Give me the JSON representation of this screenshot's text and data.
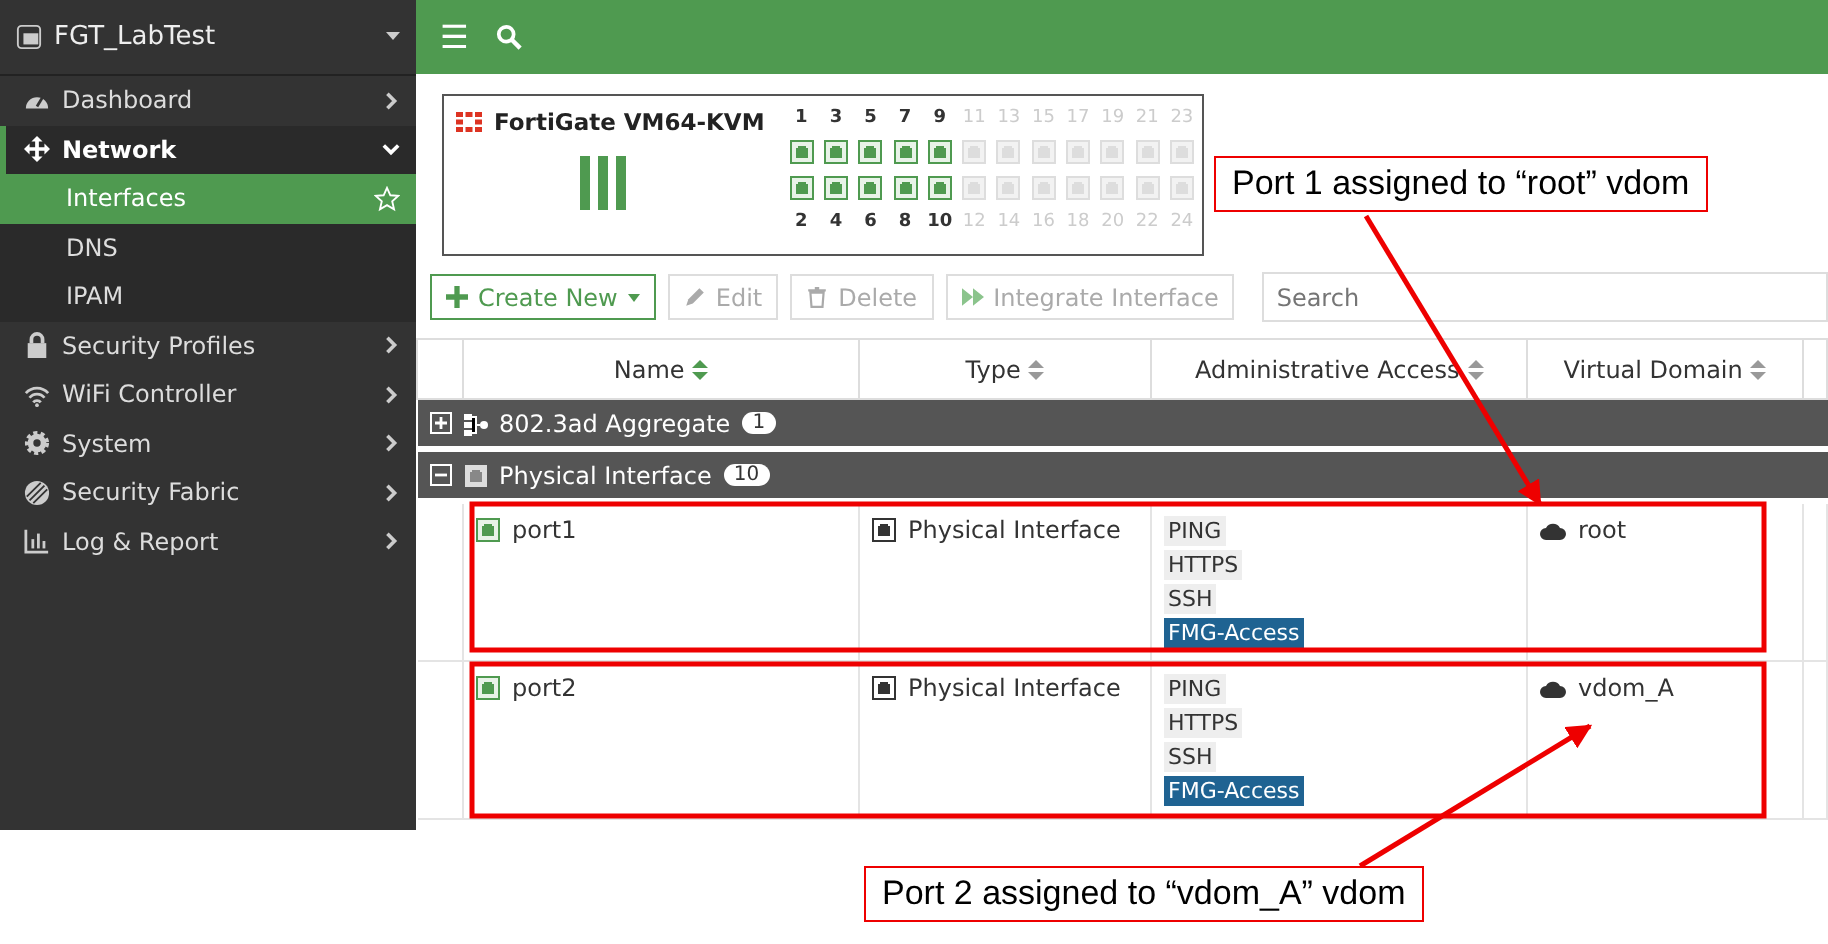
{
  "sidebar": {
    "device": "FGT_LabTest",
    "items": [
      {
        "label": "Dashboard",
        "expanded": false
      },
      {
        "label": "Network",
        "expanded": true,
        "children": [
          {
            "label": "Interfaces",
            "selected": true
          },
          {
            "label": "DNS",
            "selected": false
          },
          {
            "label": "IPAM",
            "selected": false
          }
        ]
      },
      {
        "label": "Security Profiles",
        "expanded": false
      },
      {
        "label": "WiFi Controller",
        "expanded": false
      },
      {
        "label": "System",
        "expanded": false
      },
      {
        "label": "Security Fabric",
        "expanded": false
      },
      {
        "label": "Log & Report",
        "expanded": false
      }
    ]
  },
  "topbar": {
    "menu": "☰"
  },
  "device_panel": {
    "model": "FortiGate VM64-KVM",
    "ports": [
      {
        "label": "1",
        "active": true
      },
      {
        "label": "2",
        "active": true
      },
      {
        "label": "3",
        "active": true
      },
      {
        "label": "4",
        "active": true
      },
      {
        "label": "5",
        "active": true
      },
      {
        "label": "6",
        "active": true
      },
      {
        "label": "7",
        "active": true
      },
      {
        "label": "8",
        "active": true
      },
      {
        "label": "9",
        "active": true
      },
      {
        "label": "10",
        "active": true
      },
      {
        "label": "11",
        "active": false
      },
      {
        "label": "12",
        "active": false
      },
      {
        "label": "13",
        "active": false
      },
      {
        "label": "14",
        "active": false
      },
      {
        "label": "15",
        "active": false
      },
      {
        "label": "16",
        "active": false
      },
      {
        "label": "17",
        "active": false
      },
      {
        "label": "18",
        "active": false
      },
      {
        "label": "19",
        "active": false
      },
      {
        "label": "20",
        "active": false
      },
      {
        "label": "21",
        "active": false
      },
      {
        "label": "22",
        "active": false
      },
      {
        "label": "23",
        "active": false
      },
      {
        "label": "24",
        "active": false
      }
    ]
  },
  "toolbar": {
    "buttons": [
      {
        "label": "Create New",
        "disabled": false
      },
      {
        "label": "Edit",
        "disabled": true
      },
      {
        "label": "Delete",
        "disabled": true
      },
      {
        "label": "Integrate Interface",
        "disabled": true
      }
    ],
    "search": {
      "placeholder": "Search"
    }
  },
  "table": {
    "columns": [
      {
        "label": "Name",
        "sorted": true
      },
      {
        "label": "Type",
        "sorted": false
      },
      {
        "label": "Administrative Access",
        "sorted": false
      },
      {
        "label": "Virtual Domain",
        "sorted": false
      }
    ],
    "groups": [
      {
        "label": "802.3ad Aggregate",
        "count": "1",
        "expanded": false
      },
      {
        "label": "Physical Interface",
        "count": "10",
        "expanded": true,
        "rows": [
          {
            "name": "port1",
            "type": "Physical Interface",
            "access": [
              {
                "label": "PING",
                "highlighted": false
              },
              {
                "label": "HTTPS",
                "highlighted": false
              },
              {
                "label": "SSH",
                "highlighted": false
              },
              {
                "label": "FMG-Access",
                "highlighted": true
              }
            ],
            "vdom": "root"
          },
          {
            "name": "port2",
            "type": "Physical Interface",
            "access": [
              {
                "label": "PING",
                "highlighted": false
              },
              {
                "label": "HTTPS",
                "highlighted": false
              },
              {
                "label": "SSH",
                "highlighted": false
              },
              {
                "label": "FMG-Access",
                "highlighted": true
              }
            ],
            "vdom": "vdom_A"
          }
        ]
      }
    ]
  },
  "annotations": [
    {
      "text": "Port 1 assigned to “root” vdom"
    },
    {
      "text": "Port 2 assigned to “vdom_A” vdom"
    }
  ]
}
